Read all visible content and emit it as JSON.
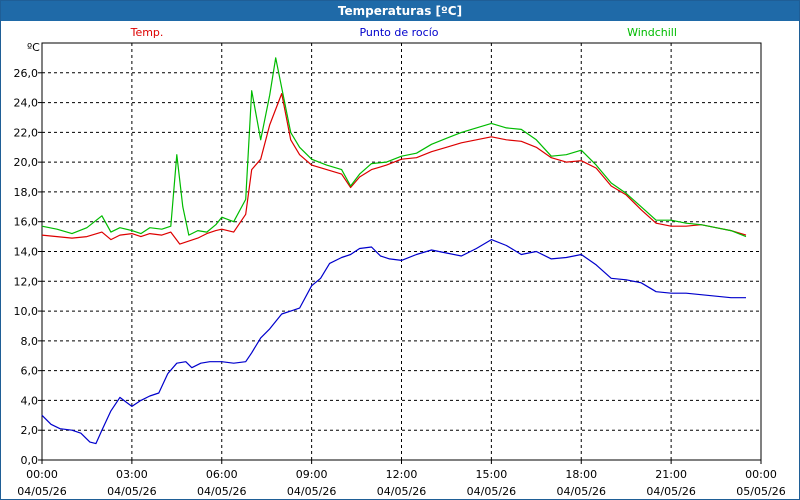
{
  "window": {
    "title": "Temperaturas [ºC]"
  },
  "chart_data": {
    "type": "line",
    "unit": "ºC",
    "ylim": [
      0,
      28
    ],
    "yticks": [
      "0,0",
      "2,0",
      "4,0",
      "6,0",
      "8,0",
      "10,0",
      "12,0",
      "14,0",
      "16,0",
      "18,0",
      "20,0",
      "22,0",
      "24,0",
      "26,0"
    ],
    "xlim": [
      0,
      24
    ],
    "xticks": [
      {
        "time": "00:00",
        "date": "04/05/26"
      },
      {
        "time": "03:00",
        "date": "04/05/26"
      },
      {
        "time": "06:00",
        "date": "04/05/26"
      },
      {
        "time": "09:00",
        "date": "04/05/26"
      },
      {
        "time": "12:00",
        "date": "04/05/26"
      },
      {
        "time": "15:00",
        "date": "04/05/26"
      },
      {
        "time": "18:00",
        "date": "04/05/26"
      },
      {
        "time": "21:00",
        "date": "04/05/26"
      },
      {
        "time": "00:00",
        "date": "05/05/26"
      }
    ],
    "grid": true,
    "legend_position": "top",
    "series": [
      {
        "name": "Temp.",
        "color": "#dd0000",
        "x": [
          0,
          0.5,
          1,
          1.5,
          2,
          2.3,
          2.6,
          3,
          3.3,
          3.6,
          4,
          4.3,
          4.6,
          4.9,
          5.2,
          5.5,
          5.8,
          6,
          6.4,
          6.8,
          7,
          7.3,
          7.6,
          8,
          8.3,
          8.6,
          9,
          9.5,
          10,
          10.3,
          10.6,
          11,
          11.5,
          12,
          12.5,
          13,
          13.5,
          14,
          14.5,
          15,
          15.5,
          16,
          16.5,
          17,
          17.5,
          18,
          18.5,
          19,
          19.5,
          20,
          20.5,
          21,
          21.5,
          22,
          22.5,
          23,
          23.5
        ],
        "y": [
          15.1,
          15.0,
          14.9,
          15.0,
          15.3,
          14.8,
          15.1,
          15.2,
          15.0,
          15.2,
          15.1,
          15.3,
          14.5,
          14.7,
          14.9,
          15.2,
          15.4,
          15.5,
          15.3,
          16.5,
          19.5,
          20.2,
          22.5,
          24.6,
          21.5,
          20.5,
          19.8,
          19.5,
          19.2,
          18.3,
          19.0,
          19.5,
          19.8,
          20.2,
          20.3,
          20.7,
          21.0,
          21.3,
          21.5,
          21.7,
          21.5,
          21.4,
          21.0,
          20.3,
          20.0,
          20.1,
          19.6,
          18.4,
          17.8,
          16.8,
          15.9,
          15.7,
          15.7,
          15.8,
          15.6,
          15.4,
          15.1
        ]
      },
      {
        "name": "Punto de rocío",
        "color": "#0000cc",
        "x": [
          0,
          0.3,
          0.6,
          1,
          1.3,
          1.6,
          1.8,
          2,
          2.3,
          2.6,
          3,
          3.3,
          3.6,
          3.9,
          4.2,
          4.5,
          4.8,
          5,
          5.3,
          5.6,
          6,
          6.4,
          6.8,
          7,
          7.3,
          7.6,
          8,
          8.3,
          8.6,
          9,
          9.3,
          9.6,
          10,
          10.3,
          10.6,
          11,
          11.3,
          11.6,
          12,
          12.5,
          13,
          13.5,
          14,
          14.5,
          15,
          15.5,
          16,
          16.5,
          17,
          17.5,
          18,
          18.5,
          19,
          19.5,
          20,
          20.5,
          21,
          21.5,
          22,
          22.5,
          23,
          23.5
        ],
        "y": [
          3.0,
          2.4,
          2.1,
          2.0,
          1.8,
          1.2,
          1.1,
          2.0,
          3.3,
          4.2,
          3.6,
          4.0,
          4.3,
          4.5,
          5.8,
          6.5,
          6.6,
          6.2,
          6.5,
          6.6,
          6.6,
          6.5,
          6.6,
          7.2,
          8.2,
          8.8,
          9.8,
          10.0,
          10.2,
          11.7,
          12.2,
          13.2,
          13.6,
          13.8,
          14.2,
          14.3,
          13.7,
          13.5,
          13.4,
          13.8,
          14.1,
          13.9,
          13.7,
          14.2,
          14.8,
          14.4,
          13.8,
          14.0,
          13.5,
          13.6,
          13.8,
          13.1,
          12.2,
          12.1,
          11.9,
          11.3,
          11.2,
          11.2,
          11.1,
          11.0,
          10.9,
          10.9
        ]
      },
      {
        "name": "Windchill",
        "color": "#00bb00",
        "x": [
          0,
          0.5,
          1,
          1.5,
          2,
          2.3,
          2.6,
          3,
          3.3,
          3.6,
          4,
          4.3,
          4.5,
          4.7,
          4.9,
          5.2,
          5.5,
          5.8,
          6,
          6.4,
          6.8,
          7,
          7.3,
          7.6,
          7.8,
          8,
          8.3,
          8.6,
          9,
          9.5,
          10,
          10.3,
          10.6,
          11,
          11.5,
          12,
          12.5,
          13,
          13.5,
          14,
          14.5,
          15,
          15.5,
          16,
          16.5,
          17,
          17.5,
          18,
          18.5,
          19,
          19.5,
          20,
          20.5,
          21,
          21.5,
          22,
          22.5,
          23,
          23.5
        ],
        "y": [
          15.7,
          15.5,
          15.2,
          15.6,
          16.4,
          15.3,
          15.6,
          15.4,
          15.2,
          15.6,
          15.5,
          15.7,
          20.5,
          17.0,
          15.1,
          15.4,
          15.3,
          15.8,
          16.3,
          16.0,
          17.5,
          24.8,
          21.5,
          24.5,
          27.0,
          25.0,
          22.0,
          21.0,
          20.2,
          19.8,
          19.5,
          18.4,
          19.2,
          19.9,
          20.0,
          20.4,
          20.6,
          21.2,
          21.6,
          22.0,
          22.3,
          22.6,
          22.3,
          22.2,
          21.5,
          20.4,
          20.5,
          20.8,
          19.8,
          18.6,
          17.9,
          17.0,
          16.1,
          16.1,
          15.9,
          15.8,
          15.6,
          15.4,
          15.0
        ]
      }
    ]
  }
}
